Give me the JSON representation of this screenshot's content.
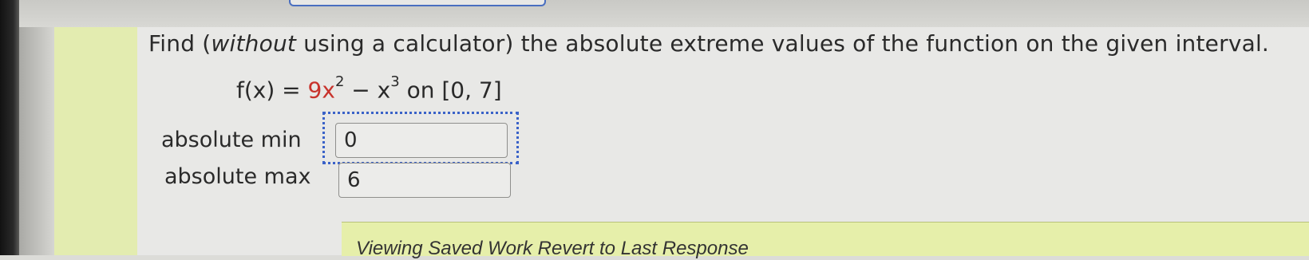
{
  "question": {
    "prefix": "Find (",
    "emphasis": "without",
    "suffix": " using a calculator) the absolute extreme values of the function on the given interval."
  },
  "formula": {
    "lhs": "f(x) = ",
    "coef": "9x",
    "exp1": "2",
    "minus": " − x",
    "exp2": "3",
    "on": " on ",
    "interval": "[0, 7]"
  },
  "fields": {
    "min_label": "absolute min",
    "min_value": "0",
    "max_label": "absolute max",
    "max_value": "6"
  },
  "footer": {
    "text": "Viewing Saved Work Revert to Last Response"
  }
}
